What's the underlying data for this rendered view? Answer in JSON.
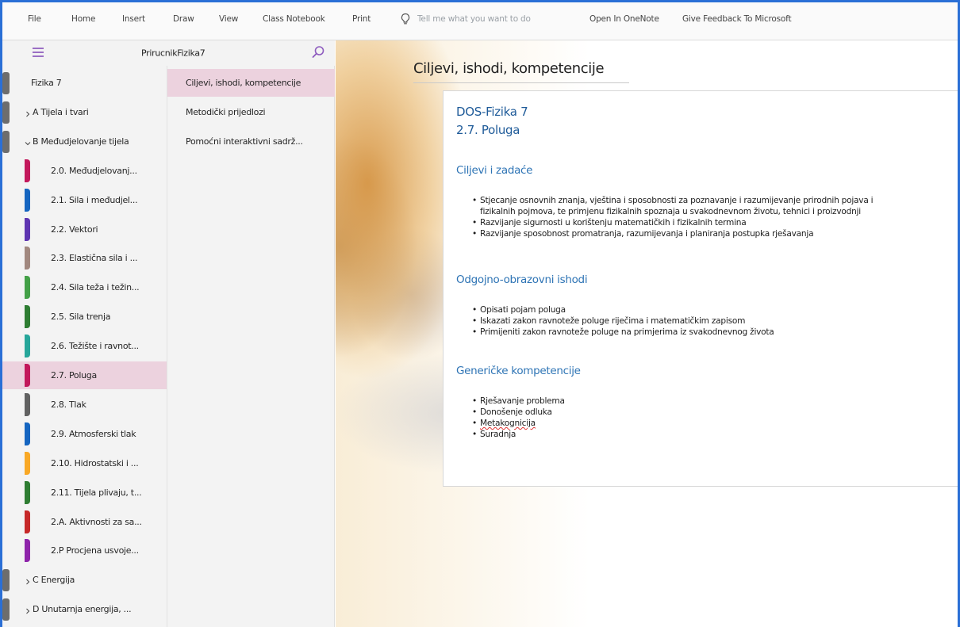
{
  "ribbon": {
    "menu": [
      "File",
      "Home",
      "Insert",
      "Draw",
      "View",
      "Class Notebook",
      "Print"
    ],
    "tell_me": "Tell me what you want to do",
    "open_in_onenote": "Open In OneNote",
    "feedback": "Give Feedback To Microsoft"
  },
  "notebook": {
    "name": "PrirucnikFizika7"
  },
  "sections": [
    {
      "label": "Fizika 7",
      "kind": "notebook-root",
      "color": "#6d6d6d"
    },
    {
      "label": "A Tijela i tvari",
      "kind": "group",
      "expand": ">"
    },
    {
      "label": "B Međudjelovanje tijela",
      "kind": "group",
      "expand": "v"
    },
    {
      "label": "2.0. Međudjelovanj...",
      "kind": "section",
      "color": "#c2185b"
    },
    {
      "label": "2.1. Sila i međudjel...",
      "kind": "section",
      "color": "#1565c0"
    },
    {
      "label": "2.2. Vektori",
      "kind": "section",
      "color": "#5e35b1"
    },
    {
      "label": "2.3. Elastična sila i ...",
      "kind": "section",
      "color": "#a1887f"
    },
    {
      "label": "2.4. Sila teža i težin...",
      "kind": "section",
      "color": "#43a047"
    },
    {
      "label": "2.5. Sila trenja",
      "kind": "section",
      "color": "#2e7d32"
    },
    {
      "label": "2.6. Težište i ravnot...",
      "kind": "section",
      "color": "#26a69a"
    },
    {
      "label": "2.7. Poluga",
      "kind": "section",
      "color": "#c2185b",
      "selected": true
    },
    {
      "label": "2.8. Tlak",
      "kind": "section",
      "color": "#616161"
    },
    {
      "label": "2.9. Atmosferski tlak",
      "kind": "section",
      "color": "#1565c0"
    },
    {
      "label": "2.10. Hidrostatski i ...",
      "kind": "section",
      "color": "#f9a825"
    },
    {
      "label": "2.11. Tijela plivaju, t...",
      "kind": "section",
      "color": "#2e7d32"
    },
    {
      "label": "2.A. Aktivnosti za sa...",
      "kind": "section",
      "color": "#c62828"
    },
    {
      "label": "2.P Procjena usvoje...",
      "kind": "section",
      "color": "#8e24aa"
    },
    {
      "label": "C Energija",
      "kind": "group",
      "expand": ">"
    },
    {
      "label": "D Unutarnja energija, ...",
      "kind": "group",
      "expand": ">"
    }
  ],
  "pages": [
    {
      "label": "Ciljevi, ishodi, kompetencije",
      "selected": true
    },
    {
      "label": "Metodički prijedlozi"
    },
    {
      "label": "Pomoćni interaktivni sadrž..."
    }
  ],
  "page": {
    "title": "Ciljevi, ishodi, kompetencije",
    "heading1": "DOS-Fizika 7",
    "heading2": "2.7. Poluga",
    "blocks": [
      {
        "heading": "Ciljevi i zadaće",
        "items": [
          "Stjecanje osnovnih znanja, vještina i sposobnosti  za poznavanje i razumijevanje prirodnih pojava i",
          "fizikalnih pojmova, te primjenu fizikalnih spoznaja u svakodnevnom životu, tehnici i proizvodnji",
          "Razvijanje sigurnosti u korištenju matematičkih i fizikalnih termina",
          "Razvijanje sposobnost promatranja, razumijevanja i planiranja postupka rješavanja"
        ]
      },
      {
        "heading": "Odgojno-obrazovni ishodi",
        "items": [
          "Opisati pojam poluga",
          "Iskazati zakon ravnoteže poluge riječima i matematičkim zapisom",
          "Primijeniti zakon ravnoteže poluge na primjerima iz svakodnevnog života"
        ]
      },
      {
        "heading": "Generičke kompetencije",
        "items": [
          "Rješavanje problema",
          "Donošenje odluka",
          "Metakognicija",
          "Suradnja"
        ]
      }
    ]
  },
  "colors": {
    "accent": "#9b6fc4",
    "selection": "#ecd2de",
    "heading_blue": "#2e74b5",
    "frame_blue": "#2a6fd6"
  }
}
